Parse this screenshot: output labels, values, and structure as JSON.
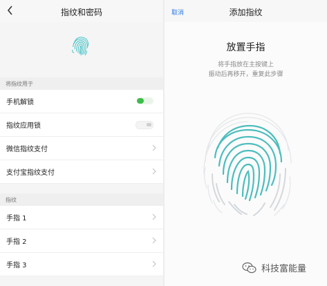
{
  "left_screen": {
    "title": "指纹和密码",
    "section_usage": "将指纹用于",
    "usage_items": [
      {
        "label": "手机解锁",
        "toggle": "on"
      },
      {
        "label": "指纹应用锁",
        "toggle": "off"
      },
      {
        "label": "微信指纹支付"
      },
      {
        "label": "支付宝指纹支付"
      }
    ],
    "section_fingerprints": "指纹",
    "fingerprints": [
      {
        "label": "手指 1"
      },
      {
        "label": "手指 2"
      },
      {
        "label": "手指 3"
      }
    ]
  },
  "right_screen": {
    "cancel_label": "取消",
    "title": "添加指纹",
    "heading": "放置手指",
    "hint_line1": "将手指放在主按键上",
    "hint_line2": "振动后再移开，重复此步骤"
  },
  "watermark": {
    "text": "科技富能量",
    "icon": "wechat-icon"
  },
  "colors": {
    "accent_blue": "#2f7be5",
    "toggle_green": "#3cbd4a",
    "fingerprint_teal": "#4dbdbd"
  }
}
